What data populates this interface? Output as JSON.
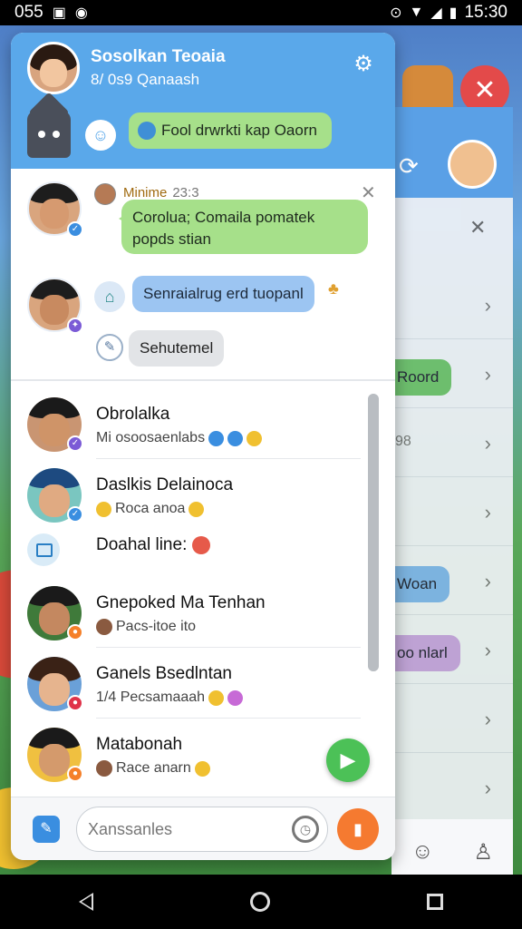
{
  "status_bar": {
    "left_text": "055",
    "time": "15:30",
    "icons": [
      "gallery-icon",
      "app-icon",
      "location-icon",
      "wifi-icon",
      "signal-icon",
      "battery-icon"
    ]
  },
  "header": {
    "title": "Sosolkan Teoaia",
    "subtitle": "8/ 0s9 Qanaash",
    "bot_message": "Fool drwrkti kap Oaorn",
    "settings_icon": "settings-icon"
  },
  "chat": {
    "sender_name": "Minime",
    "sender_time": "23:3",
    "message_green": "Corolua; Comaila pomatek popds stian",
    "message_blue": "Senraialrug erd tuopanl",
    "message_grey": "Sehutemel"
  },
  "contacts": [
    {
      "name": "Obrolalka",
      "preview": "Mi osoosaenlabs",
      "badge_color": "#7b5bd6"
    },
    {
      "name": "Daslkis Delainoca",
      "preview": "Roca anoa",
      "badge_color": "#3a8ee0"
    },
    {
      "name": "Doahal line:",
      "preview": ""
    },
    {
      "name": "Gnepoked Ma Tenhan",
      "preview": "Pacs-itoe ito",
      "badge_color": "#f5802a"
    },
    {
      "name": "Ganels Bsedlntan",
      "preview": "1/4 Pecsamaaah",
      "badge_color": "#e0334a"
    },
    {
      "name": "Matabonah",
      "preview": "Race anarn",
      "badge_color": "#f5802a"
    }
  ],
  "composer": {
    "placeholder": "Xanssanles"
  },
  "background": {
    "pills": [
      "Roord",
      "Woan",
      "oo nlarl"
    ],
    "number": "98"
  },
  "colors": {
    "header_blue": "#5aa8ea",
    "bubble_green": "#a6e08a",
    "bubble_blue": "#9cc5f2",
    "send_orange": "#f57a30",
    "fab_green": "#4cc157"
  }
}
